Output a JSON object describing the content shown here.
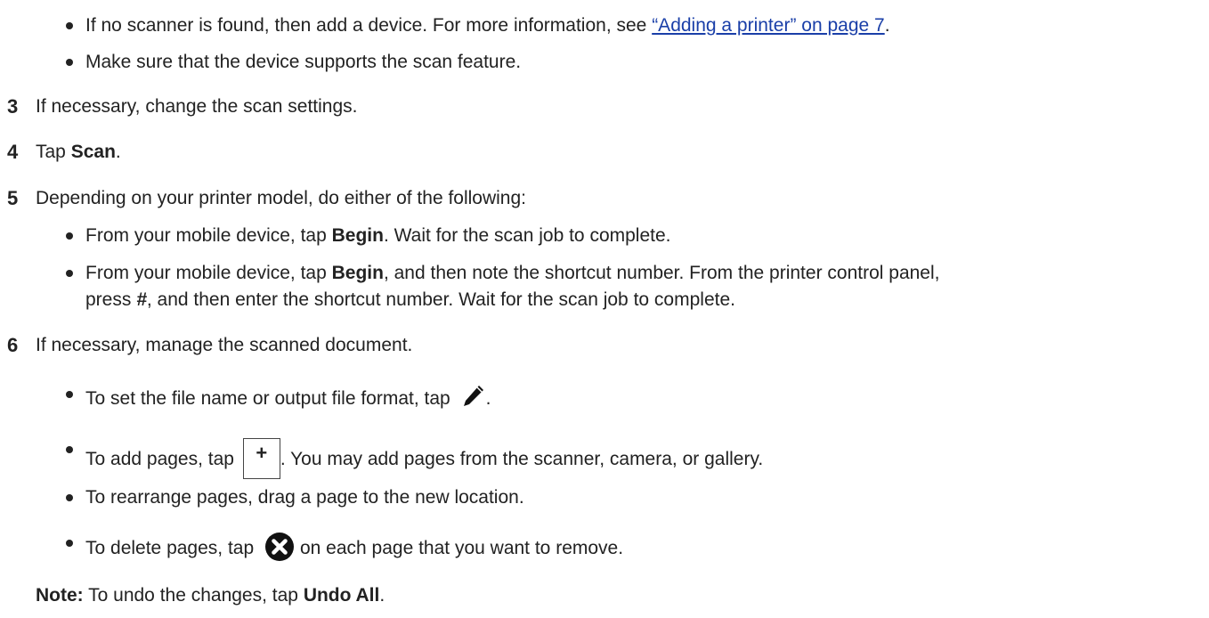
{
  "content": {
    "b1a": "If no scanner is found, then add a device. For more information, see ",
    "b1_link": "“Adding a printer” on page 7",
    "b1b": ".",
    "b2": "Make sure that the device supports the scan feature.",
    "s3_num": "3",
    "s3": "If necessary, change the scan settings.",
    "s4_num": "4",
    "s4a": "Tap ",
    "s4_bold": "Scan",
    "s4b": ".",
    "s5_num": "5",
    "s5": "Depending on your printer model, do either of the following:",
    "b3a": "From your mobile device, tap ",
    "b3_bold": "Begin",
    "b3b": ". Wait for the scan job to complete.",
    "b4a": "From your mobile device, tap ",
    "b4_bold": "Begin",
    "b4b": ", and then note the shortcut number. From the printer control panel,",
    "b4c": "press ",
    "b4_hash": "#",
    "b4d": ", and then enter the shortcut number. Wait for the scan job to complete.",
    "s6_num": "6",
    "s6": "If necessary, manage the scanned document.",
    "b5a": "To set the file name or output file format, tap ",
    "b5b": ".",
    "b6a": "To add pages, tap ",
    "b6b": ". You may add pages from the scanner, camera, or gallery.",
    "b7": "To rearrange pages, drag a page to the new location.",
    "b8a": "To delete pages, tap ",
    "b8b": "on each page that you want to remove.",
    "note_label": "Note:",
    "note_a": " To undo the changes, tap ",
    "note_bold": "Undo All",
    "note_b": "."
  },
  "icons": {
    "edit": "pencil-icon",
    "add_page": "plus-box-icon",
    "delete": "x-circle-icon"
  }
}
